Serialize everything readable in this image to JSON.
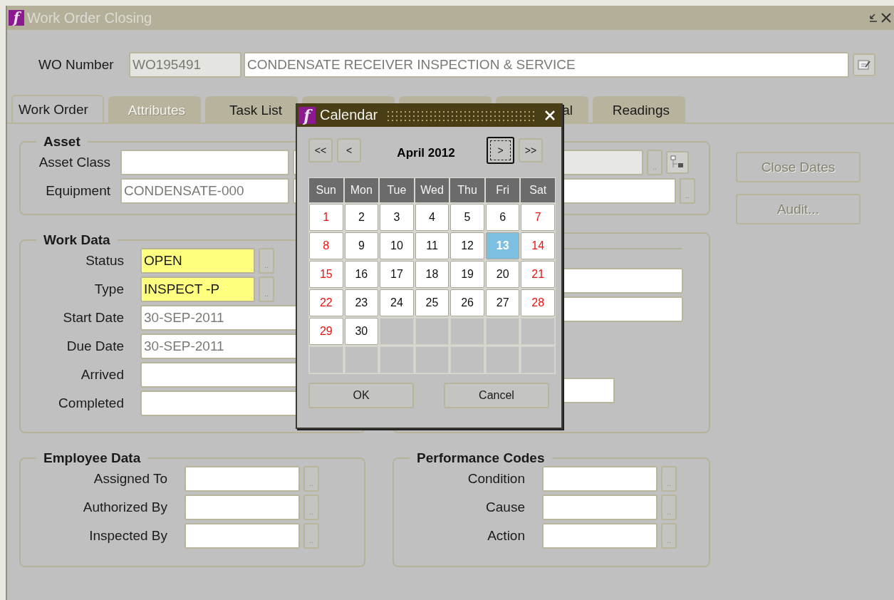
{
  "window": {
    "logo": "f",
    "title": "Work Order Closing"
  },
  "header": {
    "label": "WO Number",
    "number": "WO195491",
    "description": "CONDENSATE RECEIVER INSPECTION & SERVICE"
  },
  "tabs": [
    {
      "label": "Work Order",
      "selected": true,
      "disabled": false
    },
    {
      "label": "Attributes",
      "selected": false,
      "disabled": true
    },
    {
      "label": "Task List",
      "selected": false,
      "disabled": false
    },
    {
      "selected": false
    },
    {
      "selected": false
    },
    {
      "label": "al",
      "selected": false,
      "disabled": false
    },
    {
      "label": "Readings",
      "selected": false,
      "disabled": false
    }
  ],
  "asset": {
    "title": "Asset",
    "rows": [
      {
        "label": "Asset Class",
        "lov": "..",
        "hierarchy": true
      },
      {
        "label": "Equipment",
        "value": "CONDENSATE-000",
        "lov": "..",
        "hierarchy": false
      }
    ]
  },
  "work_data": {
    "title": "Work Data",
    "fields": [
      {
        "label": "Status",
        "value": "OPEN",
        "required": true,
        "disabled": false,
        "lov": ".."
      },
      {
        "label": "Type",
        "value": "INSPECT -P",
        "required": true,
        "disabled": false,
        "lov": ".."
      },
      {
        "label": "Start Date",
        "value": "30-SEP-2011",
        "required": false,
        "disabled": true
      },
      {
        "label": "Due Date",
        "value": "30-SEP-2011",
        "required": false,
        "disabled": true
      },
      {
        "label": "Arrived",
        "required": false
      },
      {
        "label": "Completed",
        "required": false
      }
    ]
  },
  "employee_data": {
    "title": "Employee Data",
    "fields": [
      {
        "label": "Assigned To",
        "lov": ".."
      },
      {
        "label": "Authorized By",
        "lov": ".."
      },
      {
        "label": "Inspected By",
        "lov": ".."
      }
    ]
  },
  "performance_codes": {
    "title": "Performance Codes",
    "fields": [
      {
        "label": "Condition",
        "lov": ".."
      },
      {
        "label": "Cause",
        "lov": ".."
      },
      {
        "label": "Action",
        "lov": ".."
      }
    ]
  },
  "buttons": [
    {
      "label": "Close Dates",
      "disabled": true
    },
    {
      "label": "Audit...",
      "disabled": true
    }
  ],
  "calendar": {
    "logo": "f",
    "title": "Calendar",
    "month": "April 2012",
    "nav": [
      {
        "label": "<<",
        "focused": false
      },
      {
        "label": "<",
        "focused": false
      },
      {
        "label": ">",
        "focused": true
      },
      {
        "label": ">>",
        "focused": false
      }
    ],
    "weekdays": [
      "Sun",
      "Mon",
      "Tue",
      "Wed",
      "Thu",
      "Fri",
      "Sat"
    ],
    "days": [
      {
        "label": "1",
        "weekend": true,
        "selected": false
      },
      {
        "label": "2",
        "weekend": false,
        "selected": false
      },
      {
        "label": "3",
        "weekend": false,
        "selected": false
      },
      {
        "label": "4",
        "weekend": false,
        "selected": false
      },
      {
        "label": "5",
        "weekend": false,
        "selected": false
      },
      {
        "label": "6",
        "weekend": false,
        "selected": false
      },
      {
        "label": "7",
        "weekend": true,
        "selected": false
      },
      {
        "label": "8",
        "weekend": true,
        "selected": false
      },
      {
        "label": "9",
        "weekend": false,
        "selected": false
      },
      {
        "label": "10",
        "weekend": false,
        "selected": false
      },
      {
        "label": "11",
        "weekend": false,
        "selected": false
      },
      {
        "label": "12",
        "weekend": false,
        "selected": false
      },
      {
        "label": "13",
        "weekend": false,
        "selected": true
      },
      {
        "label": "14",
        "weekend": true,
        "selected": false
      },
      {
        "label": "15",
        "weekend": true,
        "selected": false
      },
      {
        "label": "16",
        "weekend": false,
        "selected": false
      },
      {
        "label": "17",
        "weekend": false,
        "selected": false
      },
      {
        "label": "18",
        "weekend": false,
        "selected": false
      },
      {
        "label": "19",
        "weekend": false,
        "selected": false
      },
      {
        "label": "20",
        "weekend": false,
        "selected": false
      },
      {
        "label": "21",
        "weekend": true,
        "selected": false
      },
      {
        "label": "22",
        "weekend": true,
        "selected": false
      },
      {
        "label": "23",
        "weekend": false,
        "selected": false
      },
      {
        "label": "24",
        "weekend": false,
        "selected": false
      },
      {
        "label": "25",
        "weekend": false,
        "selected": false
      },
      {
        "label": "26",
        "weekend": false,
        "selected": false
      },
      {
        "label": "27",
        "weekend": false,
        "selected": false
      },
      {
        "label": "28",
        "weekend": true,
        "selected": false
      },
      {
        "label": "29",
        "weekend": true,
        "selected": false
      },
      {
        "label": "30",
        "weekend": false,
        "selected": false
      }
    ],
    "buttons": [
      "OK",
      "Cancel"
    ]
  }
}
